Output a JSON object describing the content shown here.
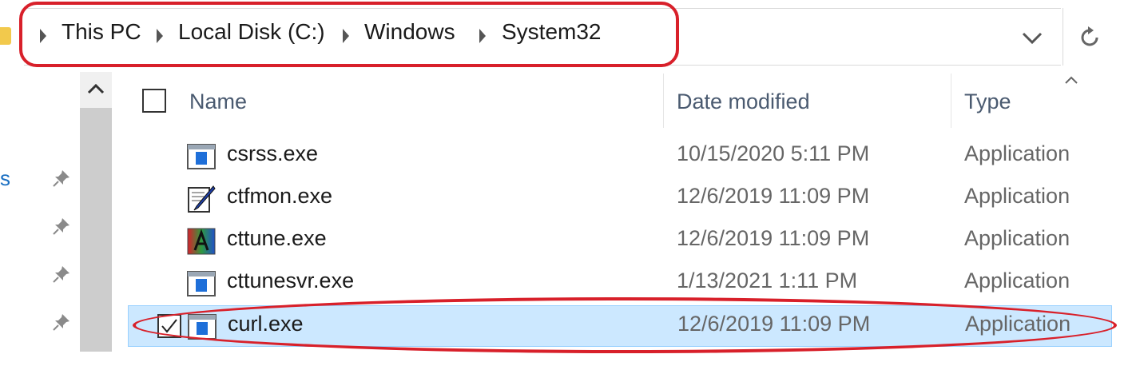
{
  "address_bar": {
    "breadcrumbs": [
      {
        "label": "This PC"
      },
      {
        "label": "Local Disk (C:)"
      },
      {
        "label": "Windows"
      },
      {
        "label": "System32"
      }
    ],
    "dropdown_icon": "chevron-down-icon",
    "refresh_icon": "refresh-icon"
  },
  "nav": {
    "fragment_text": "s",
    "pins": 4
  },
  "columns": {
    "name": "Name",
    "date_modified": "Date modified",
    "type": "Type"
  },
  "files": [
    {
      "name": "csrss.exe",
      "date": "10/15/2020 5:11 PM",
      "type": "Application",
      "icon": "app-window-icon",
      "selected": false
    },
    {
      "name": "ctfmon.exe",
      "date": "12/6/2019 11:09 PM",
      "type": "Application",
      "icon": "pen-notepad-icon",
      "selected": false
    },
    {
      "name": "cttune.exe",
      "date": "12/6/2019 11:09 PM",
      "type": "Application",
      "icon": "cleartype-a-icon",
      "selected": false
    },
    {
      "name": "cttunesvr.exe",
      "date": "1/13/2021 1:11 PM",
      "type": "Application",
      "icon": "app-window-icon",
      "selected": false
    },
    {
      "name": "curl.exe",
      "date": "12/6/2019 11:09 PM",
      "type": "Application",
      "icon": "app-window-icon",
      "selected": true
    }
  ],
  "colors": {
    "highlight_red": "#d8202a",
    "selection_bg": "#cce8ff",
    "selection_border": "#99d1ff",
    "header_text": "#4a5a70"
  }
}
